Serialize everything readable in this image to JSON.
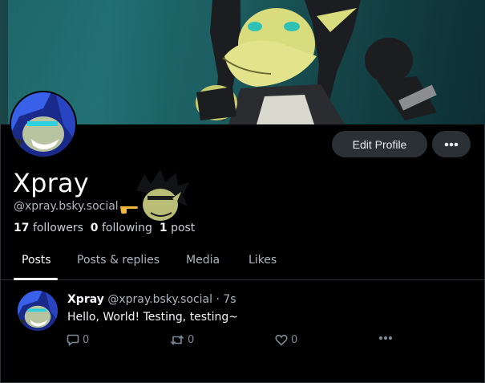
{
  "profile": {
    "display_name": "Xpray",
    "handle": "@xpray.bsky.social",
    "followers_count": "17",
    "followers_label": "followers",
    "following_count": "0",
    "following_label": "following",
    "posts_count": "1",
    "posts_label": "post"
  },
  "actions": {
    "edit_profile": "Edit Profile",
    "more": "more-icon"
  },
  "tabs": [
    {
      "label": "Posts",
      "active": true
    },
    {
      "label": "Posts & replies",
      "active": false
    },
    {
      "label": "Media",
      "active": false
    },
    {
      "label": "Likes",
      "active": false
    }
  ],
  "post": {
    "author_name": "Xpray",
    "author_handle": "@xpray.bsky.social",
    "separator": "·",
    "time": "7s",
    "text": "Hello, World! Testing, testing~",
    "reply_count": "0",
    "repost_count": "0",
    "like_count": "0"
  },
  "colors": {
    "background": "#000000",
    "button_bg": "#2b3035",
    "muted_text": "#aeb6bd",
    "action_icon": "#7d8a96"
  }
}
